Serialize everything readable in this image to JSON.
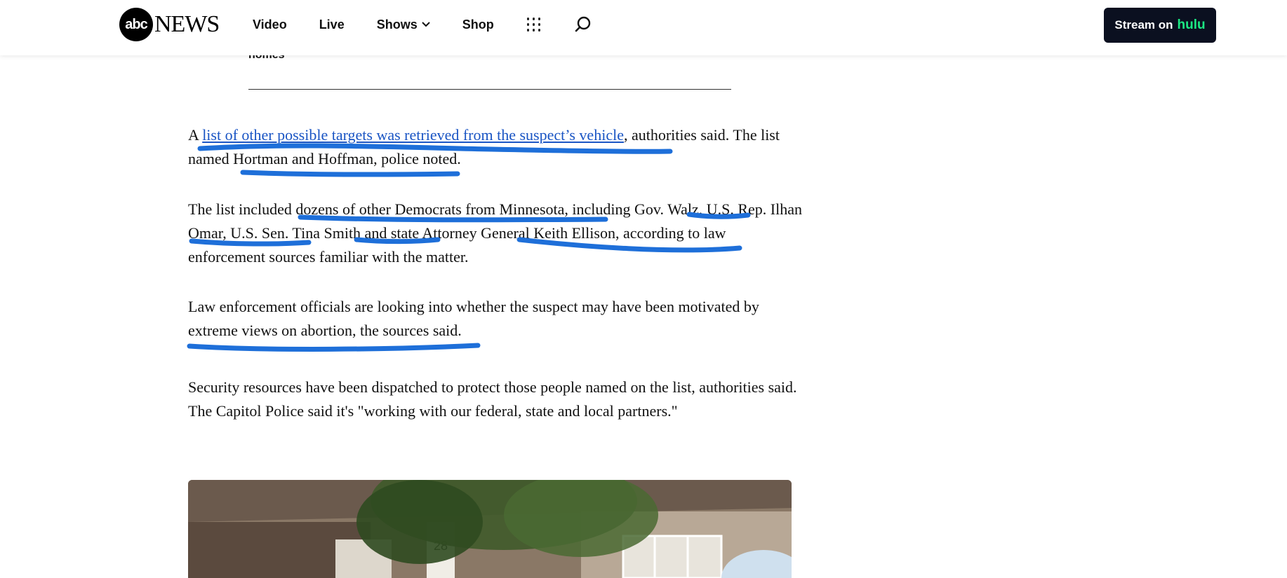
{
  "header": {
    "logo_circle": "abc",
    "logo_text": "NEWS",
    "nav": [
      {
        "label": "Video"
      },
      {
        "label": "Live"
      },
      {
        "label": "Shows"
      },
      {
        "label": "Shop"
      }
    ],
    "stream_button": {
      "prefix": "Stream on",
      "brand": "hulu"
    }
  },
  "article": {
    "caption_tail": "nomes",
    "p1": {
      "pre": "A ",
      "link": "list of other possible targets was retrieved from the suspect’s vehicle",
      "post": ", authorities said. The list named Hortman and Hoffman, police noted."
    },
    "p2": "The list included dozens of other Democrats from Minnesota, including Gov. Walz, U.S. Rep. Ilhan Omar, U.S. Sen. Tina Smith and state Attorney General Keith Ellison, according to law enforcement sources familiar with the matter.",
    "p3": "Law enforcement officials are looking into whether the suspect may have been motivated by extreme views on abortion, the sources said.",
    "p4": "Security resources have been dispatched to protect those people named on the list, authorities said. The Capitol Police said it's \"working with our federal, state and local partners.\""
  },
  "photo": {
    "house_number": "28"
  },
  "colors": {
    "link": "#1a55c4",
    "annotation": "#1e6fd9",
    "stream_button_bg": "#0b1020",
    "hulu_green": "#1ce783"
  }
}
